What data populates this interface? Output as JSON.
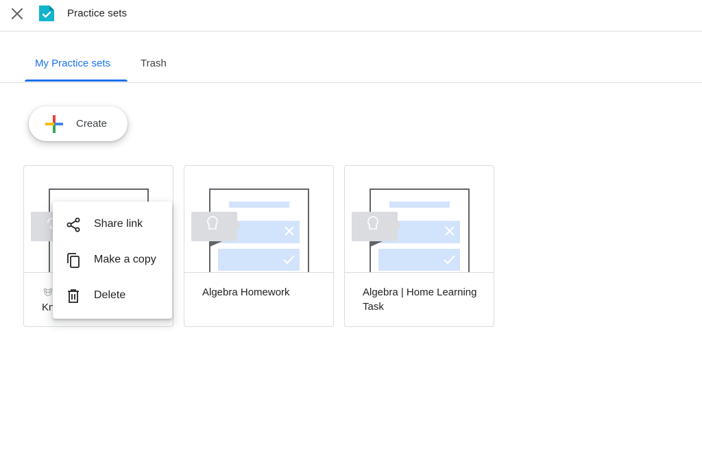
{
  "header": {
    "title": "Practice sets",
    "close_icon": "close-icon",
    "logo_icon": "practice-sets-logo-icon"
  },
  "tabs": [
    {
      "label": "My Practice sets",
      "active": true
    },
    {
      "label": "Trash",
      "active": false
    }
  ],
  "create_button": {
    "label": "Create",
    "icon": "plus-icon"
  },
  "cards": [
    {
      "title_partial": "Kn",
      "emoji_icon": "bear-emoji-icon",
      "thumbnail_icon": "practice-set-thumbnail-icon"
    },
    {
      "title": "Algebra Homework",
      "thumbnail_icon": "practice-set-thumbnail-icon"
    },
    {
      "title": "Algebra | Home Learning Task",
      "thumbnail_icon": "practice-set-thumbnail-icon"
    }
  ],
  "context_menu": {
    "items": [
      {
        "label": "Share link",
        "icon": "share-icon"
      },
      {
        "label": "Make a copy",
        "icon": "copy-icon"
      },
      {
        "label": "Delete",
        "icon": "trash-icon"
      }
    ]
  },
  "colors": {
    "accent": "#1a73e8",
    "border": "#dadce0",
    "logo": "#12b5cb",
    "thumbnail_bar": "#d2e3fc",
    "hint_box": "#dadce0"
  }
}
